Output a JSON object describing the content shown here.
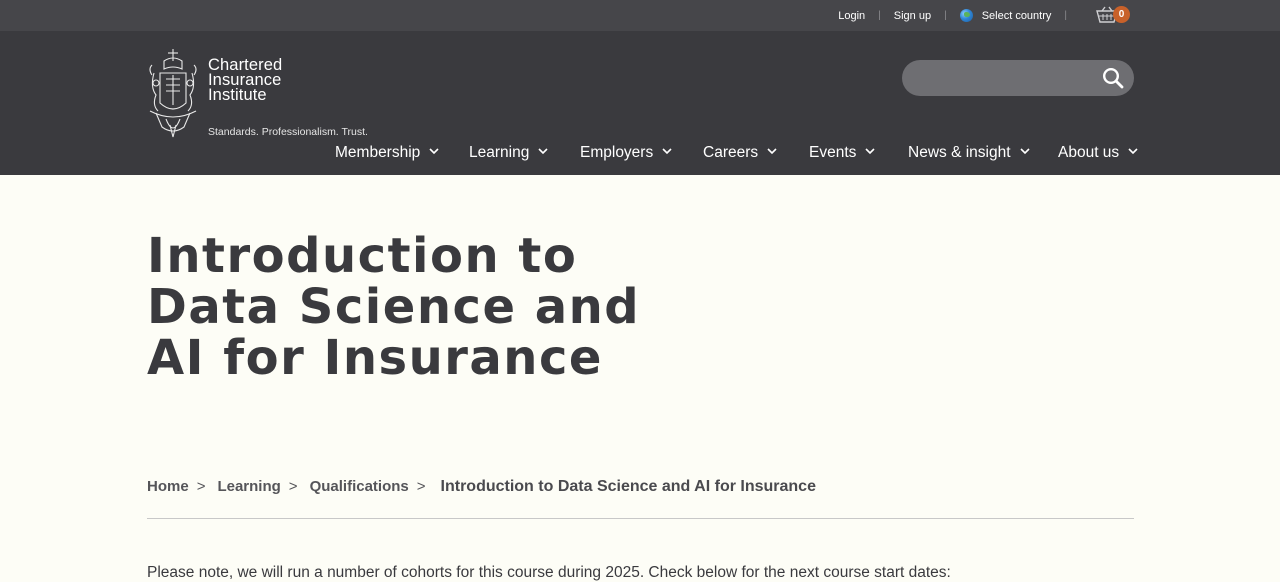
{
  "topbar": {
    "login": "Login",
    "signup": "Sign up",
    "country": "Select country",
    "cart_count": "0"
  },
  "logo": {
    "line1": "Chartered",
    "line2": "Insurance",
    "line3": "Institute",
    "tagline": "Standards. Professionalism. Trust."
  },
  "search": {
    "placeholder": ""
  },
  "nav": {
    "items": [
      {
        "label": "Membership"
      },
      {
        "label": "Learning"
      },
      {
        "label": "Employers"
      },
      {
        "label": "Careers"
      },
      {
        "label": "Events"
      },
      {
        "label": "News & insight"
      },
      {
        "label": "About us"
      }
    ]
  },
  "page": {
    "title": "Introduction to Data Science and AI for Insurance",
    "note": "Please note, we will run a number of cohorts for this course during 2025. Check below for the next course start dates:"
  },
  "breadcrumb": {
    "items": [
      "Home",
      "Learning",
      "Qualifications"
    ],
    "separator": ">",
    "current": "Introduction to Data Science and AI for Insurance"
  },
  "colors": {
    "topbar_bg": "#46464a",
    "header_bg": "#3a3a3e",
    "page_bg": "#fdfdf6",
    "cart_badge": "#c8612a",
    "title_text": "#3a3a3e"
  },
  "icons": {
    "globe": "globe-icon",
    "cart": "basket-icon",
    "search": "search-icon",
    "nav_chevron": "chevron-down-icon"
  }
}
